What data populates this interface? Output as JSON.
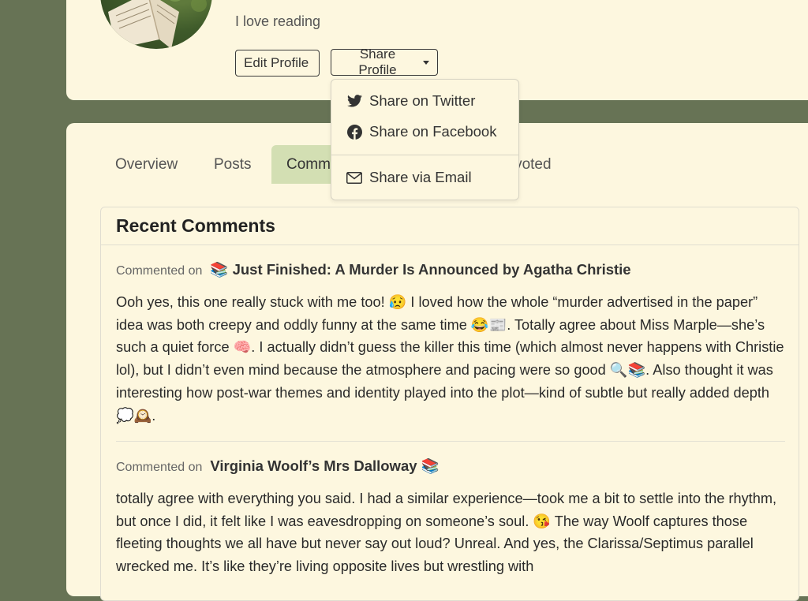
{
  "profile": {
    "bio": "I love reading",
    "edit_label": "Edit Profile",
    "share_label": "Share Profile"
  },
  "share_menu": {
    "twitter": "Share on Twitter",
    "facebook": "Share on Facebook",
    "email": "Share via Email"
  },
  "tabs": [
    {
      "label": "Overview"
    },
    {
      "label": "Posts"
    },
    {
      "label": "Comm",
      "active": true
    },
    {
      "label": "ynvoted"
    }
  ],
  "panel": {
    "title": "Recent Comments",
    "comments": [
      {
        "prefix": "Commented on",
        "post": "📚 Just Finished: A Murder Is Announced by Agatha Christie",
        "text": "Ooh yes, this one really stuck with me too! 😥 I loved how the whole “murder advertised in the paper” idea was both creepy and oddly funny at the same time 😂📰. Totally agree about Miss Marple—she’s such a quiet force 🧠. I actually didn’t guess the killer this time (which almost never happens with Christie lol), but I didn’t even mind because the atmosphere and pacing were so good 🔍📚. Also thought it was interesting how post-war themes and identity played into the plot—kind of subtle but really added depth 💭🕰️."
      },
      {
        "prefix": "Commented on",
        "post": "Virginia Woolf’s Mrs Dalloway 📚",
        "text": "totally agree with everything you said. I had a similar experience—took me a bit to settle into the rhythm, but once I did, it felt like I was eavesdropping on someone’s soul. 😘 The way Woolf captures those fleeting thoughts we all have but never say out loud? Unreal. And yes, the Clarissa/Septimus parallel wrecked me. It’s like they’re living opposite lives but wrestling with"
      }
    ]
  },
  "colors": {
    "background": "#677355",
    "card": "#fdf7df",
    "active_tab": "#d3dfb3"
  }
}
